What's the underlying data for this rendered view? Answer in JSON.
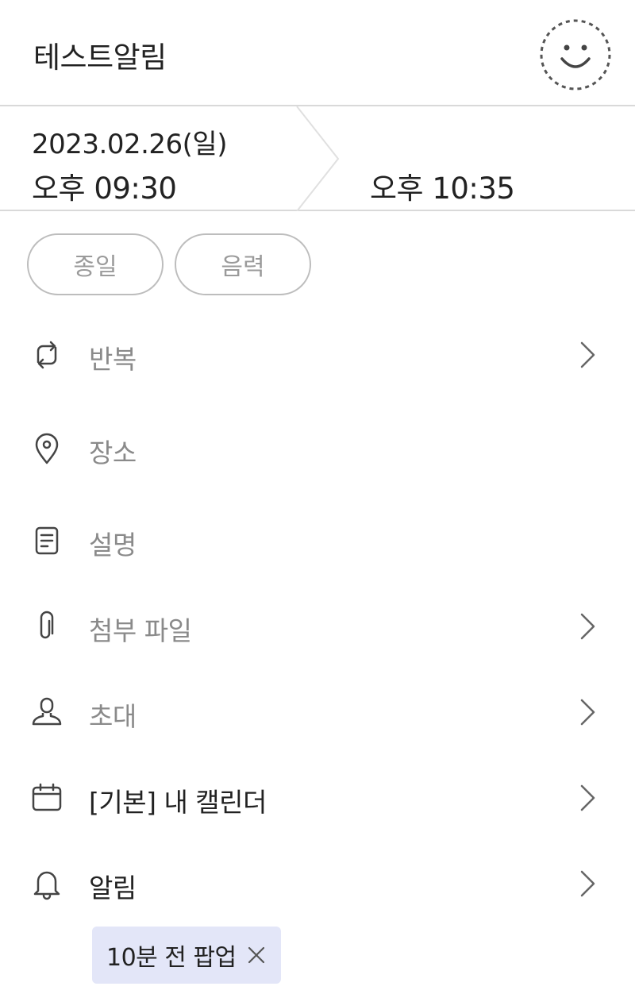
{
  "header": {
    "title": "테스트알림",
    "sticker_icon": "smiley-dashed-icon"
  },
  "datetime": {
    "start_date": "2023.02.26(일)",
    "start_time": "오후 09:30",
    "end_time": "오후 10:35"
  },
  "options": {
    "all_day_label": "종일",
    "lunar_label": "음력"
  },
  "rows": [
    {
      "key": "repeat",
      "label": "반복",
      "icon": "repeat-icon",
      "has_chevron": true
    },
    {
      "key": "location",
      "label": "장소",
      "icon": "location-pin-icon",
      "has_chevron": false
    },
    {
      "key": "description",
      "label": "설명",
      "icon": "document-icon",
      "has_chevron": false
    },
    {
      "key": "attachment",
      "label": "첨부 파일",
      "icon": "paperclip-icon",
      "has_chevron": true
    },
    {
      "key": "invite",
      "label": "초대",
      "icon": "person-icon",
      "has_chevron": true
    },
    {
      "key": "calendar",
      "label": "[기본] 내 캘린더",
      "icon": "calendar-icon",
      "has_chevron": true
    },
    {
      "key": "alert",
      "label": "알림",
      "icon": "bell-icon",
      "has_chevron": true
    }
  ],
  "alert_tag": {
    "label": "10분 전 팝업"
  },
  "colors": {
    "tag_bg": "#e3e6f8",
    "muted_text": "#8a8a8a",
    "divider": "#d9d9d9"
  }
}
